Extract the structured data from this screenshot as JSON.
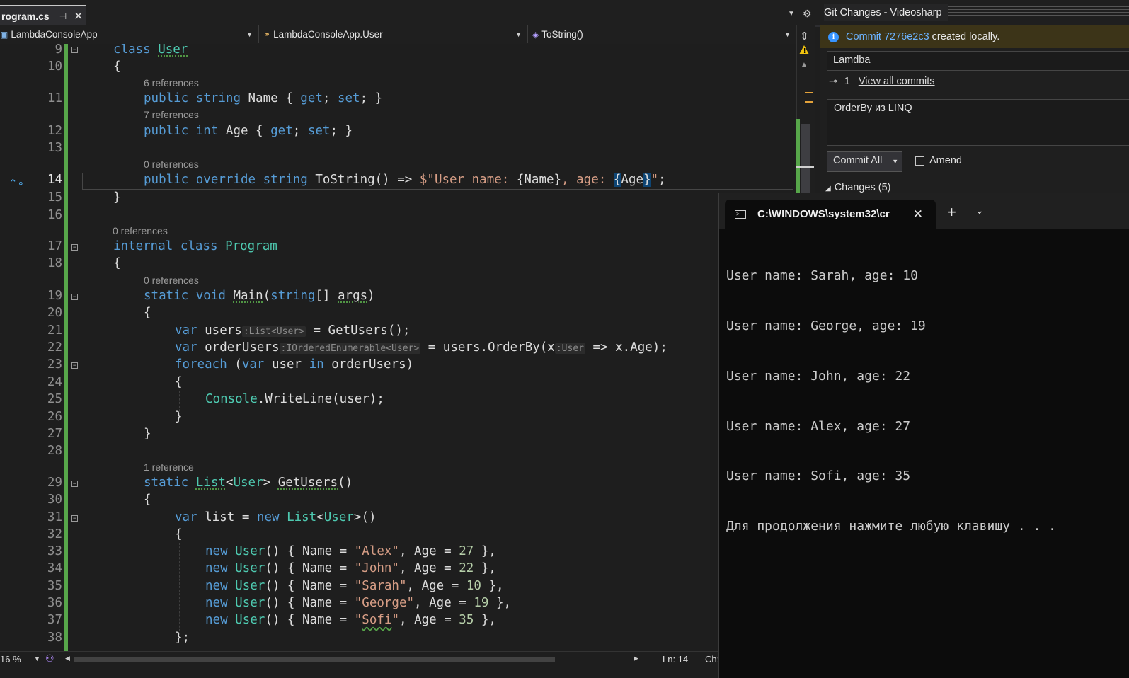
{
  "editor": {
    "tab": {
      "name": "rogram.cs",
      "pin_icon": "pin-icon",
      "close_icon": "close-icon"
    },
    "nav": {
      "project": "LambdaConsoleApp",
      "type": "LambdaConsoleApp.User",
      "member": "ToString()"
    },
    "lenses": {
      "l10": "6 references",
      "l11": "7 references",
      "l13": "0 references",
      "l16": "0 references",
      "l18": "0 references",
      "l28": "1 reference"
    },
    "line_numbers": [
      "9",
      "10",
      "11",
      "12",
      "13",
      "14",
      "15",
      "16",
      "17",
      "18",
      "19",
      "20",
      "21",
      "22",
      "23",
      "24",
      "25",
      "26",
      "27",
      "28",
      "29",
      "30",
      "31",
      "32",
      "33",
      "34",
      "35",
      "36",
      "37",
      "38"
    ],
    "status": {
      "zoom": "16 %",
      "ln": "Ln: 14",
      "ch": "Ch:"
    }
  },
  "git": {
    "title": "Git Changes - Videosharp",
    "info_link": "Commit 7276e2c3",
    "info_text": "created locally.",
    "branch": "Lamdba",
    "commit_count": "1",
    "view_all": "View all commits",
    "commit_message": "OrderBy из LINQ",
    "commit_button": "Commit All",
    "amend_label": "Amend",
    "changes_label": "Changes (5)"
  },
  "terminal": {
    "title": "C:\\WINDOWS\\system32\\cr",
    "output": [
      "User name: Sarah, age: 10",
      "User name: George, age: 19",
      "User name: John, age: 22",
      "User name: Alex, age: 27",
      "User name: Sofi, age: 35",
      "Для продолжения нажмите любую клавишу . . ."
    ]
  },
  "colors": {
    "keyword": "#569cd6",
    "type": "#4ec9b0",
    "string": "#d69d85",
    "number": "#b5cea8",
    "change_bar": "#57a64a",
    "info_bar": "#3c3418"
  }
}
